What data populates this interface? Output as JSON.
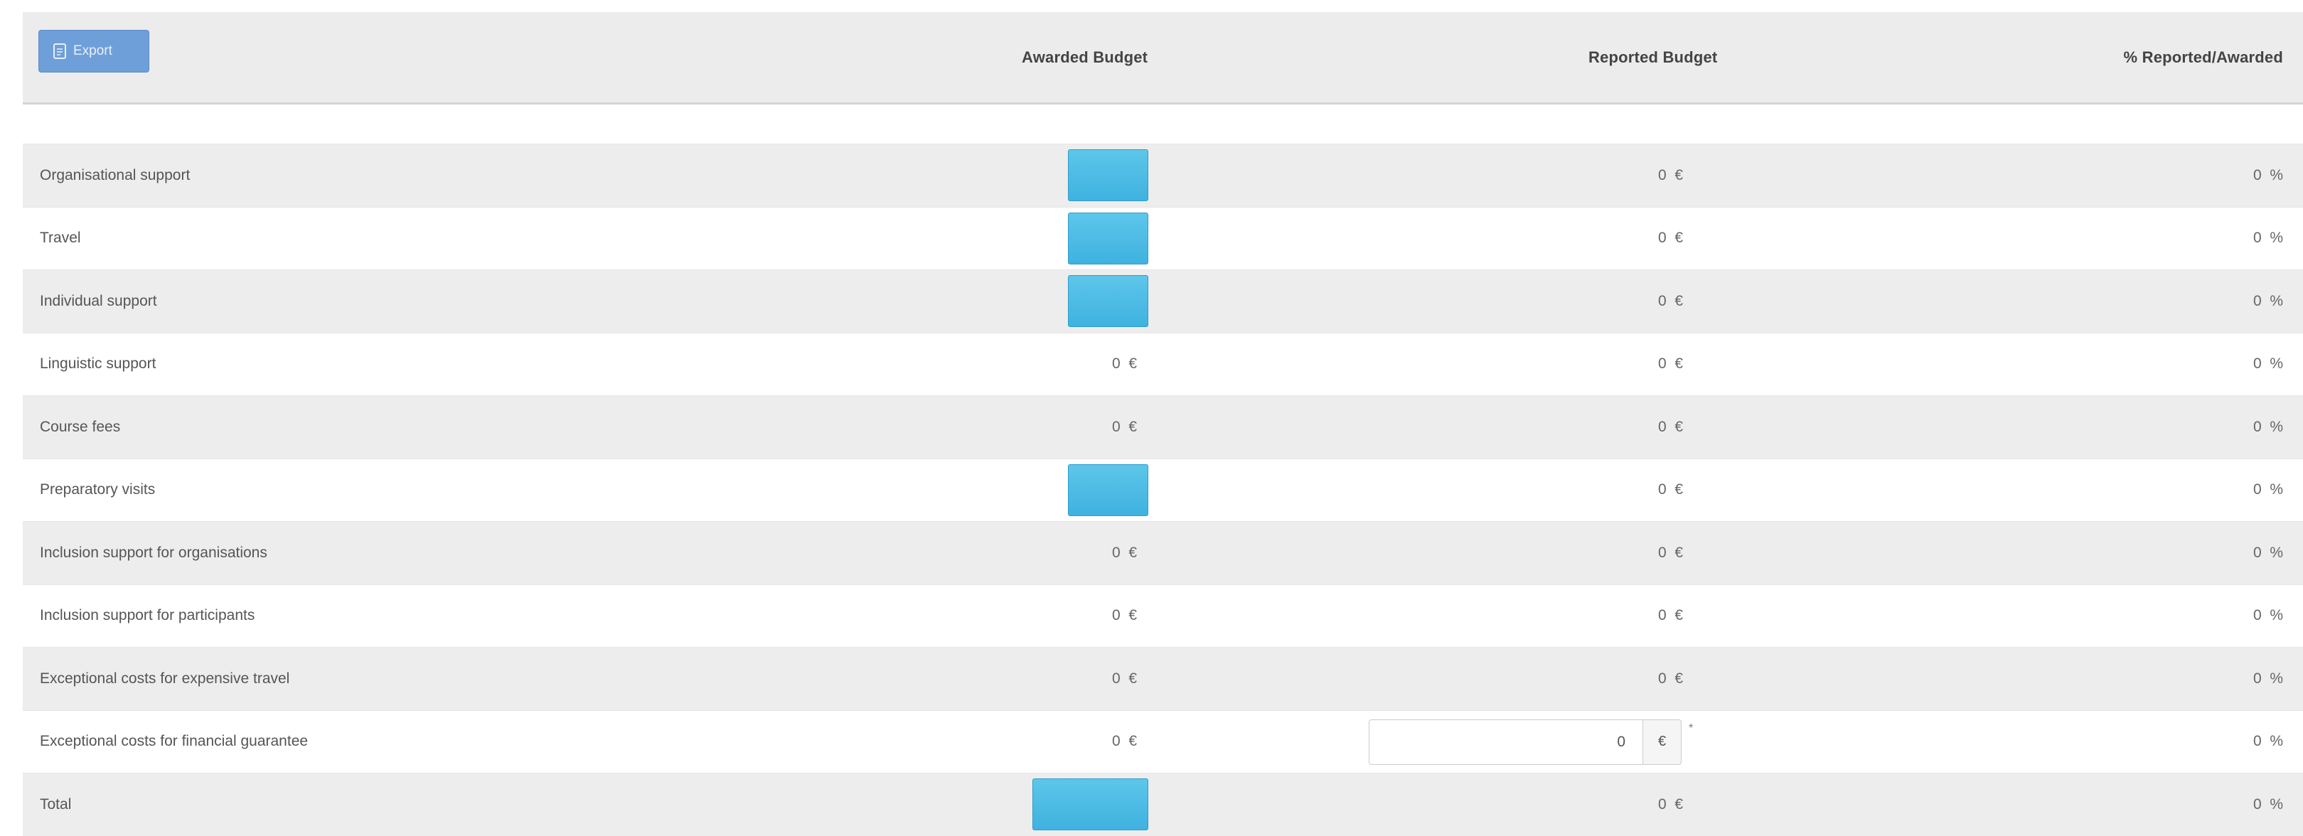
{
  "toolbar": {
    "export_label": "Export",
    "export_icon": "export-document-icon"
  },
  "columns": {
    "awarded": "Awarded Budget",
    "reported": "Reported Budget",
    "percent": "% Reported/Awarded"
  },
  "colors": {
    "header_bg": "#ececec",
    "row_alt_bg": "#ededed",
    "export_button": "#6f9fd8",
    "highlight_box": "#4fbde6"
  },
  "rows": [
    {
      "label": "Organisational support",
      "awarded": "",
      "awarded_highlight": true,
      "reported": "0  €",
      "percent": "0  %"
    },
    {
      "label": "Travel",
      "awarded": "",
      "awarded_highlight": true,
      "reported": "0  €",
      "percent": "0  %"
    },
    {
      "label": "Individual support",
      "awarded": "",
      "awarded_highlight": true,
      "reported": "0  €",
      "percent": "0  %"
    },
    {
      "label": "Linguistic support",
      "awarded": "0  €",
      "awarded_highlight": false,
      "reported": "0  €",
      "percent": "0  %"
    },
    {
      "label": "Course fees",
      "awarded": "0  €",
      "awarded_highlight": false,
      "reported": "0  €",
      "percent": "0  %"
    },
    {
      "label": "Preparatory visits",
      "awarded": "",
      "awarded_highlight": true,
      "reported": "0  €",
      "percent": "0  %"
    },
    {
      "label": "Inclusion support for organisations",
      "awarded": "0  €",
      "awarded_highlight": false,
      "reported": "0  €",
      "percent": "0  %"
    },
    {
      "label": "Inclusion support for participants",
      "awarded": "0  €",
      "awarded_highlight": false,
      "reported": "0  €",
      "percent": "0  %"
    },
    {
      "label": "Exceptional costs for expensive travel",
      "awarded": "0  €",
      "awarded_highlight": false,
      "reported": "0  €",
      "percent": "0  %"
    },
    {
      "label": "Exceptional costs for financial guarantee",
      "awarded": "0  €",
      "awarded_highlight": false,
      "reported_input": "0",
      "reported_unit": "€",
      "required_mark": "*",
      "percent": "0  %"
    },
    {
      "label": "Total",
      "awarded": "",
      "awarded_highlight": true,
      "reported": "0  €",
      "percent": "0  %"
    }
  ]
}
